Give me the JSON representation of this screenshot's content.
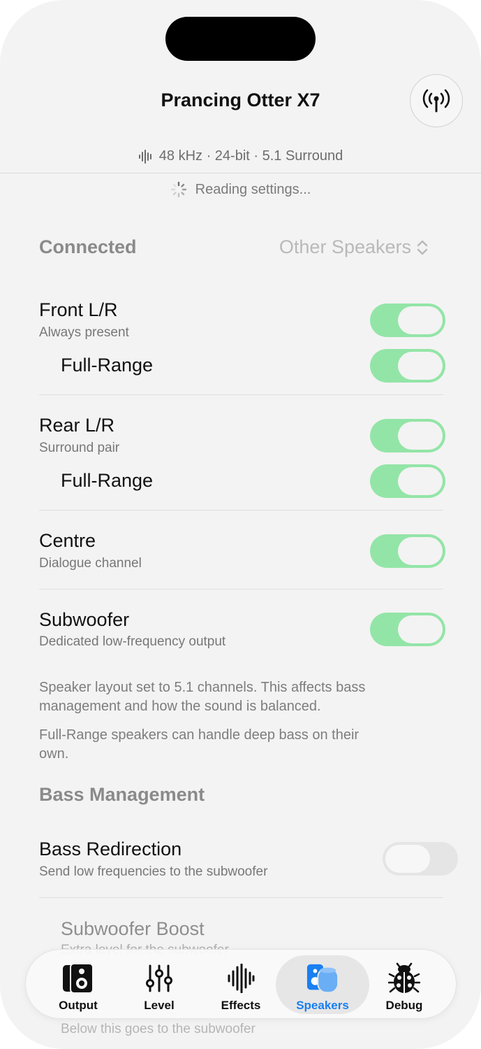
{
  "header": {
    "title": "Prancing Otter X7",
    "format": "48 kHz · 24-bit · 5.1 Surround",
    "status": "Reading settings..."
  },
  "connected": {
    "heading": "Connected",
    "other_speakers": "Other Speakers",
    "rows": [
      {
        "title": "Front L/R",
        "subtitle": "Always present",
        "on": true,
        "full_range_label": "Full-Range",
        "full_range_on": true
      },
      {
        "title": "Rear L/R",
        "subtitle": "Surround pair",
        "on": true,
        "full_range_label": "Full-Range",
        "full_range_on": true
      },
      {
        "title": "Centre",
        "subtitle": "Dialogue channel",
        "on": true
      },
      {
        "title": "Subwoofer",
        "subtitle": "Dedicated low-frequency output",
        "on": true
      }
    ],
    "note1": "Speaker layout set to 5.1 channels. This affects bass management and how the sound is balanced.",
    "note2": "Full-Range speakers can handle deep bass on their own."
  },
  "bass": {
    "heading": "Bass Management",
    "redirection_title": "Bass Redirection",
    "redirection_subtitle": "Send low frequencies to the subwoofer",
    "redirection_on": false,
    "boost_title": "Subwoofer Boost",
    "boost_subtitle": "Extra level for the subwoofer",
    "below_text": "Below this goes to the subwoofer"
  },
  "tabs": [
    {
      "label": "Output",
      "icon": "speaker-box-icon"
    },
    {
      "label": "Level",
      "icon": "sliders-icon"
    },
    {
      "label": "Effects",
      "icon": "waveform-icon"
    },
    {
      "label": "Speakers",
      "icon": "homepod-speakers-icon",
      "active": true
    },
    {
      "label": "Debug",
      "icon": "ladybug-icon"
    }
  ],
  "colors": {
    "toggle_on": "#93e5a7",
    "accent": "#1a7ff0",
    "background": "#f3f3f3"
  }
}
